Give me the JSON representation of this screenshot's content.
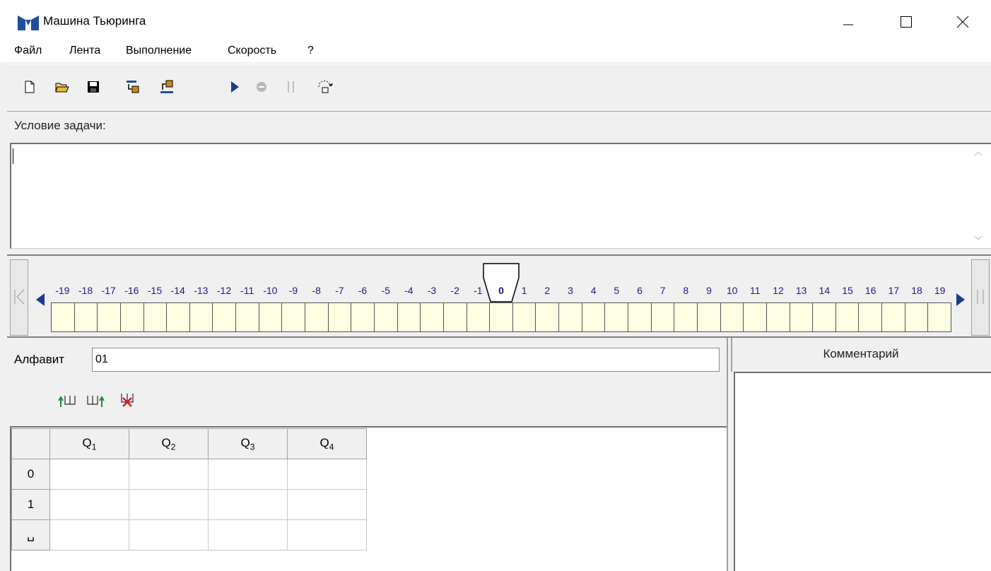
{
  "window": {
    "title": "Машина Тьюринга"
  },
  "menu": [
    "Файл",
    "Лента",
    "Выполнение",
    "Скорость",
    "?"
  ],
  "toolbar": {
    "icons": [
      "new-file-icon",
      "open-folder-icon",
      "save-icon",
      "tape-load-icon",
      "tape-save-icon",
      "run-icon",
      "stop-icon",
      "pause-icon",
      "step-icon"
    ]
  },
  "task": {
    "label": "Условие задачи:",
    "text": ""
  },
  "tape": {
    "ticks": [
      "-19",
      "-18",
      "-17",
      "-16",
      "-15",
      "-14",
      "-13",
      "-12",
      "-11",
      "-10",
      "-9",
      "-8",
      "-7",
      "-6",
      "-5",
      "-4",
      "-3",
      "-2",
      "-1",
      "0",
      "1",
      "2",
      "3",
      "4",
      "5",
      "6",
      "7",
      "8",
      "9",
      "10",
      "11",
      "12",
      "13",
      "14",
      "15",
      "16",
      "17",
      "18",
      "19"
    ],
    "head_position": "0"
  },
  "alphabet": {
    "label": "Алфавит",
    "value": "01"
  },
  "comment": {
    "title": "Комментарий",
    "text": ""
  },
  "table": {
    "states": [
      "Q",
      "Q",
      "Q",
      "Q"
    ],
    "state_indices": [
      "1",
      "2",
      "3",
      "4"
    ],
    "rows": [
      "0",
      "1",
      "␣"
    ]
  },
  "colors": {
    "tape_cell": "#fdfde2",
    "tick_text": "#1c1c8c",
    "icon_blue": "#1f4e9c"
  }
}
